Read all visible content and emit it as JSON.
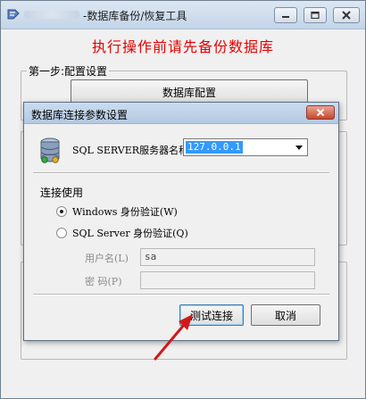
{
  "main_window": {
    "title": "-数据库备份/恢复工具",
    "warning": "执行操作前请先备份数据库",
    "step1_legend": "第一步:配置设置",
    "db_config_button": "数据库配置"
  },
  "dialog": {
    "title": "数据库连接参数设置",
    "server_label": "SQL SERVER服务器名称",
    "server_value": "127.0.0.1",
    "auth_label": "连接使用",
    "windows_auth": "Windows 身份验证(W)",
    "sql_auth": "SQL Server 身份验证(Q)",
    "username_label": "用户名(L)",
    "username_value": "sa",
    "password_label": "密  码(P)",
    "password_value": "",
    "test_button": "测试连接",
    "cancel_button": "取消"
  },
  "colors": {
    "warning_red": "#e60000",
    "selection_blue": "#3399ff",
    "annotation_red": "#d01818"
  }
}
